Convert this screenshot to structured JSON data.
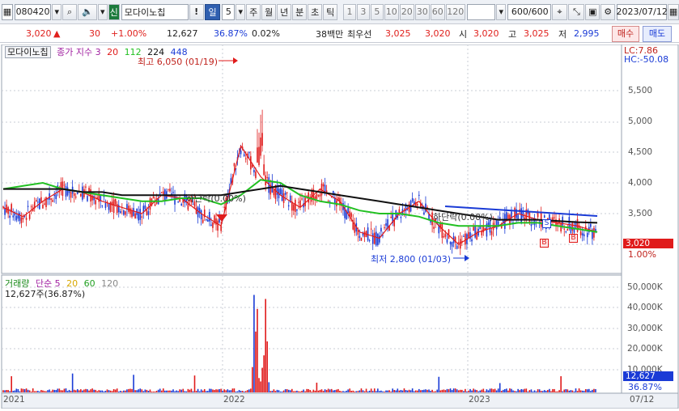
{
  "toolbar": {
    "code": "080420",
    "badge": "신",
    "name": "모다이노칩",
    "warn": "!",
    "period_sel": "일",
    "period_num": "5",
    "periods": [
      "주",
      "월",
      "년",
      "분",
      "초",
      "틱"
    ],
    "minute_opts": [
      "1",
      "3",
      "5",
      "10",
      "20",
      "30",
      "60",
      "120"
    ],
    "count": "600",
    "count_total": "/600",
    "date": "2023/07/12"
  },
  "quote": {
    "price": "3,020",
    "change": "30",
    "rate": "+1.00%",
    "volume": "12,627",
    "vol_ratio": "36.87%",
    "turnover": "0.02%",
    "amount": "38백만",
    "best_label": "최우선",
    "ask": "3,025",
    "bid": "3,020",
    "open_label": "시",
    "open": "3,020",
    "high_label": "고",
    "high": "3,025",
    "low_label": "저",
    "low": "2,995",
    "buy_btn": "매수",
    "sell_btn": "매도"
  },
  "price_panel": {
    "name": "모다이노칩",
    "legend_prefix": "종가 지수 3",
    "ma": [
      {
        "label": "20",
        "color": "#e01b1b"
      },
      {
        "label": "112",
        "color": "#22c022"
      },
      {
        "label": "224",
        "color": "#111111"
      },
      {
        "label": "448",
        "color": "#1a3bd6"
      }
    ],
    "lc": "LC:7.86",
    "hc": "HC:-50.08",
    "high_note": "최고 6,050 (01/19)",
    "low_note": "최저 2,800 (01/03)",
    "cross_note1": "하단락(0.00%)",
    "cross_note2": "하단락(0.00%)",
    "current_tag": "3,020",
    "current_rate": "1.00%",
    "markers": [
      "S",
      "B",
      "B"
    ]
  },
  "volume_panel": {
    "title": "거래량",
    "legend": "단순 5",
    "ma": [
      {
        "label": "20",
        "color": "#d8a800"
      },
      {
        "label": "60",
        "color": "#22a022"
      },
      {
        "label": "120",
        "color": "#888888"
      }
    ],
    "current": "12,627주(36.87%)",
    "tag": "12,627",
    "tag2": "36.87%"
  },
  "x_axis": {
    "labels": [
      "2021",
      "2022",
      "2023"
    ],
    "end_label": "07/12"
  },
  "chart_data": {
    "type": "line",
    "price_axis": {
      "ticks": [
        1000,
        1500,
        2000,
        2500,
        3000,
        3500,
        4000,
        4500,
        5000,
        5500
      ],
      "labels": [
        "5,500",
        "5,000",
        "4,500",
        "4,000",
        "3,500"
      ]
    },
    "volume_axis": {
      "labels": [
        "50,000K",
        "40,000K",
        "30,000K",
        "20,000K",
        "10,000K"
      ]
    },
    "series": [
      {
        "name": "20",
        "values": [
          3600,
          3450,
          3700,
          3900,
          3850,
          3700,
          3600,
          3500,
          3800,
          3750,
          3500,
          3300,
          4600,
          4100,
          3800,
          3600,
          3900,
          3700,
          3200,
          3100,
          3500,
          3700,
          3300,
          3000,
          3200,
          3300,
          3500,
          3400,
          3350,
          3300,
          3200
        ]
      },
      {
        "name": "112",
        "values": [
          3900,
          3950,
          4000,
          3900,
          3850,
          3800,
          3750,
          3700,
          3700,
          3750,
          3750,
          3650,
          3800,
          4050,
          4000,
          3800,
          3700,
          3650,
          3550,
          3500,
          3500,
          3450,
          3350,
          3300,
          3300,
          3300,
          3350,
          3350,
          3300,
          3250,
          3200
        ]
      },
      {
        "name": "224",
        "values": [
          3900,
          3900,
          3900,
          3900,
          3850,
          3850,
          3800,
          3800,
          3800,
          3800,
          3800,
          3800,
          3850,
          3900,
          3950,
          3900,
          3850,
          3800,
          3750,
          3700,
          3650,
          3600,
          3550,
          3500,
          3450,
          3400,
          3400,
          3400,
          3380,
          3360,
          3350
        ]
      },
      {
        "name": "448",
        "values": [
          3600,
          3600,
          3600,
          3580,
          3560,
          3540,
          3520,
          3500,
          3480
        ]
      }
    ]
  }
}
